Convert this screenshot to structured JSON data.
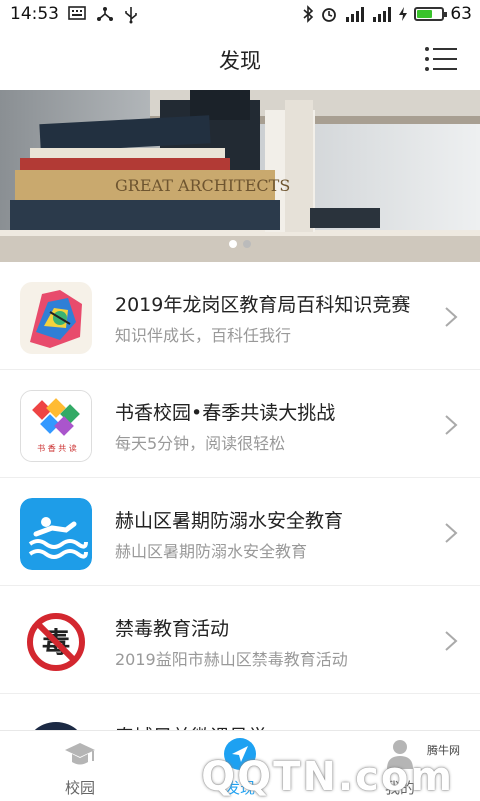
{
  "status_bar": {
    "time": "14:53",
    "battery": "63",
    "battery_level": 0.63,
    "network": "4G"
  },
  "header": {
    "title": "发现"
  },
  "banner": {
    "book_title": "GREAT ARCHITECTS"
  },
  "list": [
    {
      "title": "2019年龙岗区教育局百科知识竞赛",
      "subtitle": "知识伴成长，百科任我行",
      "icon": "colorful-art-icon"
    },
    {
      "title": "书香校园•春季共读大挑战",
      "subtitle": "每天5分钟，阅读很轻松",
      "icon": "book-reading-icon",
      "thumb_text": "书 香 共 读"
    },
    {
      "title": "赫山区暑期防溺水安全教育",
      "subtitle": "赫山区暑期防溺水安全教育",
      "icon": "swimming-icon"
    },
    {
      "title": "禁毒教育活动",
      "subtitle": "2019益阳市赫山区禁毒教育活动",
      "icon": "no-drugs-icon",
      "thumb_text": "毒"
    },
    {
      "title": "泰城兄弟微课号学",
      "subtitle": "",
      "icon": "badge-icon"
    }
  ],
  "tabs": [
    {
      "label": "校园",
      "icon": "graduation-cap-icon"
    },
    {
      "label": "发现",
      "icon": "compass-icon"
    },
    {
      "label": "我的",
      "icon": "person-icon"
    }
  ],
  "watermark": {
    "small": "腾牛网",
    "big": "QQTN.com"
  },
  "colors": {
    "accent": "#1da1f2",
    "battery": "#39c32b"
  }
}
